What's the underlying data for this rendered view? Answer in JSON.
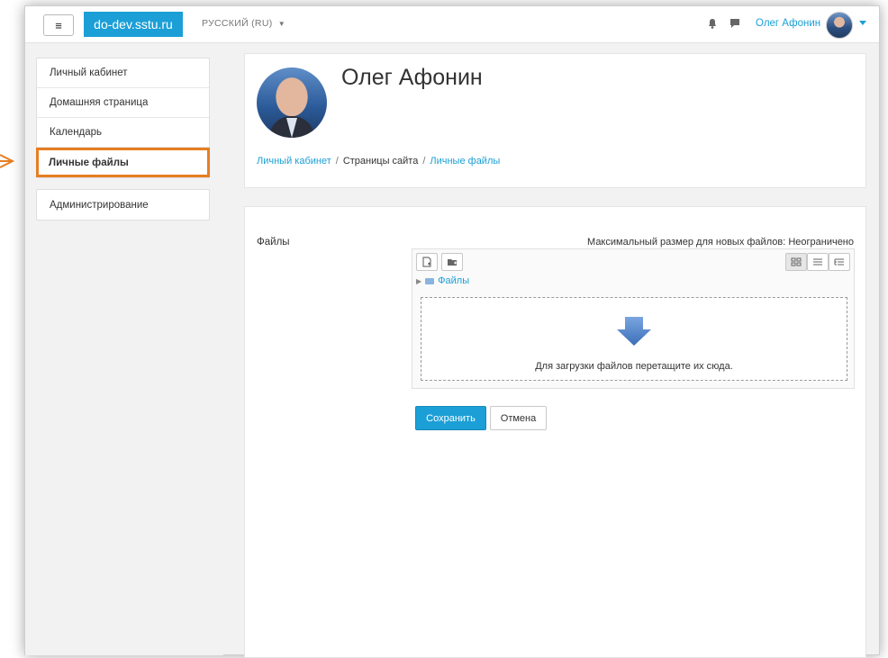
{
  "navbar": {
    "menu_icon": "hamburger-icon",
    "brand": "do-dev.sstu.ru",
    "language": "РУССКИЙ (RU)",
    "user_name": "Олег Афонин",
    "icons": [
      "bell-icon",
      "chat-icon"
    ]
  },
  "nav_drawer": {
    "items": [
      {
        "label": "Личный кабинет"
      },
      {
        "label": "Домашняя страница"
      },
      {
        "label": "Календарь"
      },
      {
        "label": "Личные файлы",
        "active": true
      }
    ],
    "admin": {
      "label": "Администрирование"
    }
  },
  "header": {
    "title": "Олег Афонин",
    "breadcrumb": [
      {
        "label": "Личный кабинет",
        "link": true
      },
      {
        "label": "Страницы сайта",
        "link": false
      },
      {
        "label": "Личные файлы",
        "link": true
      }
    ]
  },
  "files_form": {
    "label": "Файлы",
    "max_size": "Максимальный размер для новых файлов: Неограничено",
    "path_folder": "Файлы",
    "drop_hint": "Для загрузки файлов перетащите их сюда.",
    "save_button": "Сохранить",
    "cancel_button": "Отмена"
  },
  "colors": {
    "accent": "#1b9fd6",
    "highlight": "#e67e22",
    "background": "#f2f2f2"
  }
}
